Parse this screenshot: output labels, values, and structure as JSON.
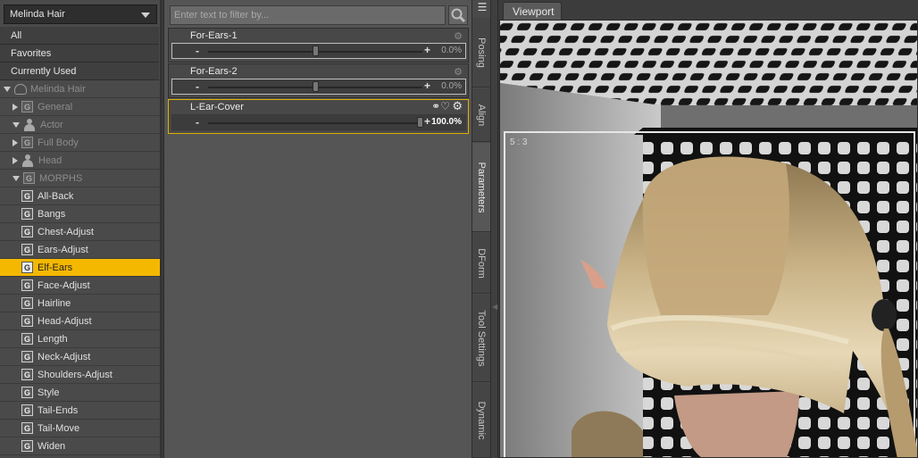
{
  "left_panel": {
    "node_select": "Melinda Hair",
    "filters": [
      "All",
      "Favorites",
      "Currently Used"
    ],
    "tree": [
      {
        "label": "Melinda Hair",
        "indent": 0,
        "twisty": "down",
        "icon": "cloud-icon",
        "dim": true
      },
      {
        "label": "General",
        "indent": 1,
        "twisty": "right",
        "icon": "g-icon",
        "dim": true
      },
      {
        "label": "Actor",
        "indent": 1,
        "twisty": "down",
        "icon": "figure-icon",
        "dim": true
      },
      {
        "label": "Full Body",
        "indent": 2,
        "twisty": "right",
        "icon": "g-icon",
        "dim": true
      },
      {
        "label": "Head",
        "indent": 2,
        "twisty": "right",
        "icon": "figure-icon",
        "dim": true
      },
      {
        "label": "MORPHS",
        "indent": 2,
        "twisty": "down",
        "icon": "g-icon",
        "dim": true
      },
      {
        "label": "All-Back",
        "indent": 3,
        "icon": "g-icon"
      },
      {
        "label": "Bangs",
        "indent": 3,
        "icon": "g-icon"
      },
      {
        "label": "Chest-Adjust",
        "indent": 3,
        "icon": "g-icon"
      },
      {
        "label": "Ears-Adjust",
        "indent": 3,
        "icon": "g-icon"
      },
      {
        "label": "Elf-Ears",
        "indent": 3,
        "icon": "g-icon",
        "selected": true
      },
      {
        "label": "Face-Adjust",
        "indent": 3,
        "icon": "g-icon"
      },
      {
        "label": "Hairline",
        "indent": 3,
        "icon": "g-icon"
      },
      {
        "label": "Head-Adjust",
        "indent": 3,
        "icon": "g-icon"
      },
      {
        "label": "Length",
        "indent": 3,
        "icon": "g-icon"
      },
      {
        "label": "Neck-Adjust",
        "indent": 3,
        "icon": "g-icon"
      },
      {
        "label": "Shoulders-Adjust",
        "indent": 3,
        "icon": "g-icon"
      },
      {
        "label": "Style",
        "indent": 3,
        "icon": "g-icon"
      },
      {
        "label": "Tail-Ends",
        "indent": 3,
        "icon": "g-icon"
      },
      {
        "label": "Tail-Move",
        "indent": 3,
        "icon": "g-icon"
      },
      {
        "label": "Widen",
        "indent": 3,
        "icon": "g-icon"
      }
    ]
  },
  "params": {
    "filter_placeholder": "Enter text to filter by...",
    "items": [
      {
        "name": "For-Ears-1",
        "value": "0.0%",
        "level": 0.5,
        "active": false
      },
      {
        "name": "For-Ears-2",
        "value": "0.0%",
        "level": 0.5,
        "active": false
      },
      {
        "name": "L-Ear-Cover",
        "value": "100.0%",
        "level": 1.0,
        "active": true
      }
    ]
  },
  "side_tabs": [
    "Posing",
    "Align",
    "Parameters",
    "DForm",
    "Tool Settings",
    "Dynamic"
  ],
  "active_side_tab": "Parameters",
  "viewport": {
    "tab": "Viewport",
    "aspect": "5 : 3"
  }
}
